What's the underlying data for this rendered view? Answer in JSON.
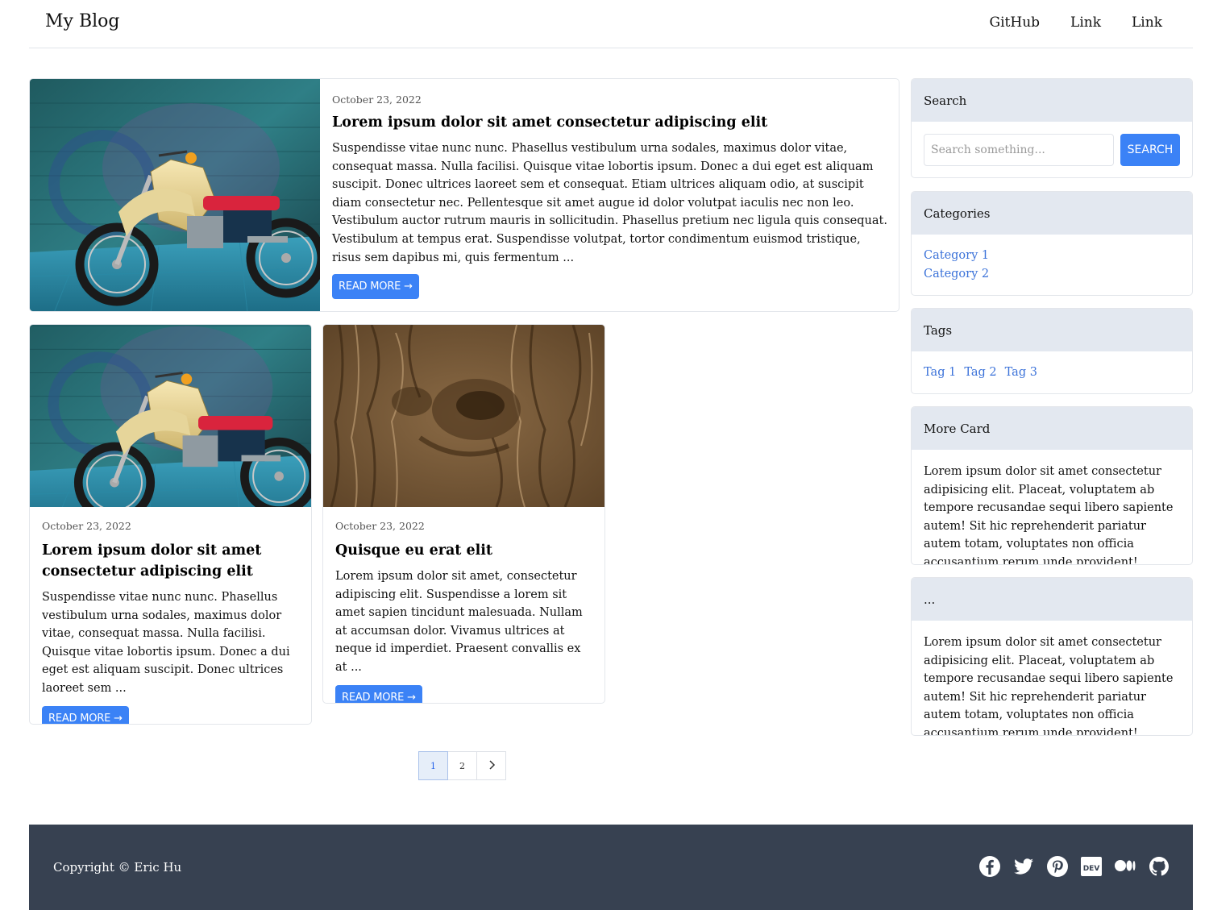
{
  "navbar": {
    "brand": "My Blog",
    "links": [
      "GitHub",
      "Link",
      "Link"
    ]
  },
  "featured_post": {
    "date": "October 23, 2022",
    "title": "Lorem ipsum dolor sit amet consectetur adipiscing elit",
    "excerpt": "Suspendisse vitae nunc nunc. Phasellus vestibulum urna sodales, maximus dolor vitae, consequat massa. Nulla facilisi. Quisque vitae lobortis ipsum. Donec a dui eget est aliquam suscipit. Donec ultrices laoreet sem et consequat. Etiam ultrices aliquam odio, at suscipit diam consectetur nec. Pellentesque sit amet augue id dolor volutpat iaculis nec non leo. Vestibulum auctor rutrum mauris in sollicitudin. Phasellus pretium nec ligula quis consequat. Vestibulum at tempus erat. Suspendisse volutpat, tortor condimentum euismod tristique, risus sem dapibus mi, quis fermentum ...",
    "button": "READ MORE →",
    "image": "motorcycle"
  },
  "posts": [
    {
      "date": "October 23, 2022",
      "title": "Lorem ipsum dolor sit amet consectetur adipiscing elit",
      "excerpt": "Suspendisse vitae nunc nunc. Phasellus vestibulum urna sodales, maximus dolor vitae, consequat massa. Nulla facilisi. Quisque vitae lobortis ipsum. Donec a dui eget est aliquam suscipit. Donec ultrices laoreet sem ...",
      "button": "READ MORE →",
      "image": "motorcycle"
    },
    {
      "date": "October 23, 2022",
      "title": "Quisque eu erat elit",
      "excerpt": "Lorem ipsum dolor sit amet, consectetur adipiscing elit. Suspendisse a lorem sit amet sapien tincidunt malesuada. Nullam at accumsan dolor. Vivamus ultrices at neque id imperdiet. Praesent convallis ex at ...",
      "button": "READ MORE →",
      "image": "tree-bark"
    }
  ],
  "pagination": {
    "pages": [
      "1",
      "2"
    ],
    "current": "1",
    "next": "›"
  },
  "sidebar": {
    "search": {
      "title": "Search",
      "placeholder": "Search something...",
      "button": "SEARCH"
    },
    "categories": {
      "title": "Categories",
      "items": [
        "Category 1",
        "Category 2"
      ]
    },
    "tags": {
      "title": "Tags",
      "items": [
        "Tag 1",
        "Tag 2",
        "Tag 3"
      ]
    },
    "more_card": {
      "title": "More Card",
      "text": "Lorem ipsum dolor sit amet consectetur adipisicing elit. Placeat, voluptatem ab tempore recusandae sequi libero sapiente autem! Sit hic reprehenderit pariatur autem totam, voluptates non officia accusantium rerum unde provident!"
    },
    "ellipsis_card": {
      "title": "...",
      "text": "Lorem ipsum dolor sit amet consectetur adipisicing elit. Placeat, voluptatem ab tempore recusandae sequi libero sapiente autem! Sit hic reprehenderit pariatur autem totam, voluptates non officia accusantium rerum unde provident!"
    }
  },
  "footer": {
    "copyright": "Copyright © Eric Hu",
    "social_icons": [
      "facebook-icon",
      "twitter-icon",
      "pinterest-icon",
      "dev-icon",
      "medium-icon",
      "github-icon"
    ]
  },
  "colors": {
    "accent": "#3b82f6",
    "link": "#3b72d9",
    "sidebar_header": "#e3e8f0",
    "footer_bg": "#374151"
  }
}
